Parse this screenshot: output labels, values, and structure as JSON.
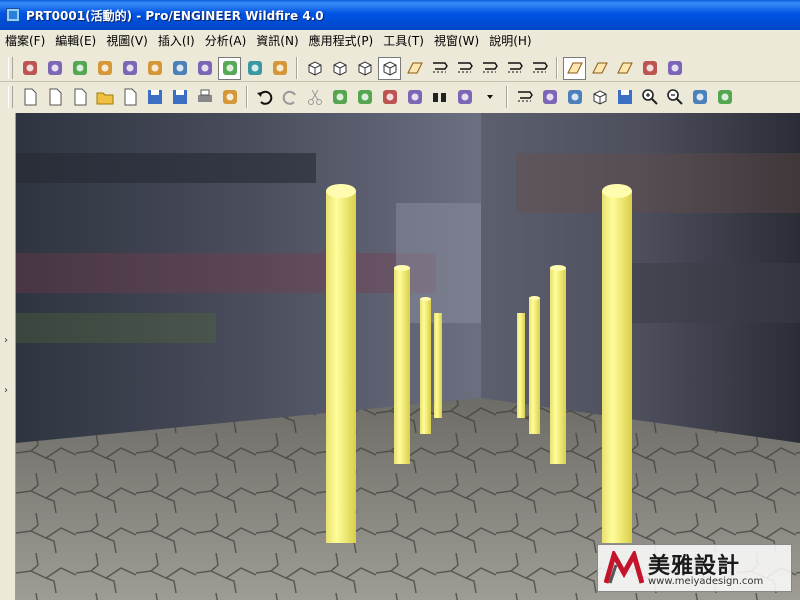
{
  "window": {
    "title": "PRT0001(活動的) - Pro/ENGINEER Wildfire 4.0"
  },
  "menu": [
    {
      "label": "檔案(F)"
    },
    {
      "label": "編輯(E)"
    },
    {
      "label": "視圖(V)"
    },
    {
      "label": "插入(I)"
    },
    {
      "label": "分析(A)"
    },
    {
      "label": "資訊(N)"
    },
    {
      "label": "應用程式(P)"
    },
    {
      "label": "工具(T)"
    },
    {
      "label": "視窗(W)"
    },
    {
      "label": "說明(H)"
    }
  ],
  "toolbar1": [
    {
      "icon": "appearance-gallery-icon"
    },
    {
      "icon": "scene-icon"
    },
    {
      "icon": "room-editor-icon"
    },
    {
      "icon": "light-editor-icon"
    },
    {
      "icon": "light-bulb-icon"
    },
    {
      "icon": "render-setup-icon"
    },
    {
      "icon": "teapot-render-icon"
    },
    {
      "icon": "teapot-region-icon"
    },
    {
      "icon": "render-window-icon",
      "active": true
    },
    {
      "icon": "photo-render-icon"
    },
    {
      "icon": "decal-tool-icon"
    },
    {
      "icon": "view-default-icon"
    },
    {
      "icon": "view-shade-icon"
    },
    {
      "icon": "view-hidden-icon"
    },
    {
      "icon": "view-shaded-cube-icon",
      "active": true
    },
    {
      "icon": "datum-points-icon"
    },
    {
      "icon": "sketch-tool-1-icon"
    },
    {
      "icon": "sketch-tool-2-icon"
    },
    {
      "icon": "sketch-tool-3-icon"
    },
    {
      "icon": "sketch-tool-4-icon"
    },
    {
      "icon": "sketch-tool-5-icon"
    },
    {
      "icon": "datum-plane-display-icon",
      "active": true
    },
    {
      "icon": "datum-axis-display-icon"
    },
    {
      "icon": "datum-point-display-icon"
    },
    {
      "icon": "coordinate-system-display-icon"
    },
    {
      "icon": "annotation-display-icon"
    }
  ],
  "toolbar2": [
    {
      "icon": "new-session-icon"
    },
    {
      "icon": "open-session-icon"
    },
    {
      "icon": "new-file-icon"
    },
    {
      "icon": "open-folder-icon"
    },
    {
      "icon": "open-file-icon"
    },
    {
      "icon": "save-icon"
    },
    {
      "icon": "save-copy-icon"
    },
    {
      "icon": "print-icon"
    },
    {
      "icon": "send-mail-icon"
    },
    {
      "icon": "undo-icon"
    },
    {
      "icon": "redo-icon"
    },
    {
      "icon": "cut-icon"
    },
    {
      "icon": "copy-icon"
    },
    {
      "icon": "paste-icon"
    },
    {
      "icon": "paste-special-icon"
    },
    {
      "icon": "regenerate-icon"
    },
    {
      "icon": "find-icon"
    },
    {
      "icon": "select-box-icon"
    },
    {
      "icon": "dropdown-arrow-icon"
    },
    {
      "icon": "sketch-path-icon"
    },
    {
      "icon": "spin-center-icon"
    },
    {
      "icon": "layers-icon"
    },
    {
      "icon": "view-manager-icon"
    },
    {
      "icon": "saved-views-icon"
    },
    {
      "icon": "zoom-in-icon"
    },
    {
      "icon": "zoom-out-icon"
    },
    {
      "icon": "refit-icon"
    },
    {
      "icon": "orient-icon"
    }
  ],
  "watermark": {
    "brand": "美雅設計",
    "url": "www.meiyadesign.com"
  }
}
